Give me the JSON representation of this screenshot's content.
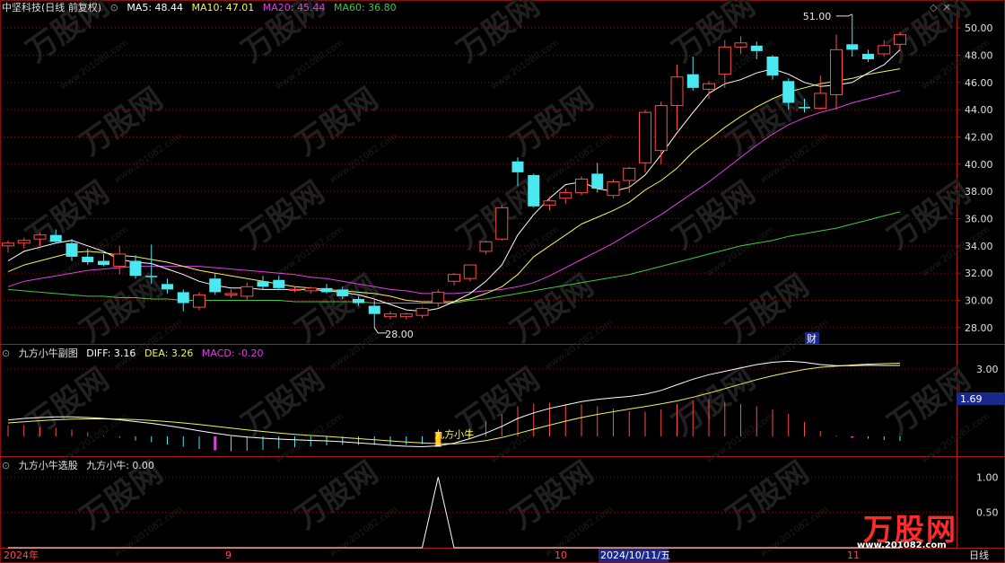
{
  "header": {
    "stock_label": "中坚科技(日线 前复权)",
    "ma5": "MA5: 48.44",
    "ma10": "MA10: 47.01",
    "ma20": "MA20: 45.44",
    "ma60": "MA60: 36.80"
  },
  "sub1": {
    "title": "九方小牛副图",
    "diff": "DIFF: 3.16",
    "dea": "DEA: 3.26",
    "macd": "MACD: -0.20",
    "marker_text": "九方小牛",
    "side_value": "1.69"
  },
  "sub2": {
    "title": "九方小牛选股",
    "value": "九方小牛: 0.00"
  },
  "annotations": {
    "high_label": "51.00",
    "low_label": "28.00",
    "event_badge": "财"
  },
  "bottom_bar": {
    "year": "2024年",
    "m9": "9",
    "m10": "10",
    "cursor_date": "2024/10/11/五",
    "m11": "11",
    "period": "日线"
  },
  "watermark": {
    "brand": "万股网",
    "url": "www.201082.com"
  },
  "colors": {
    "up": "#ff4a4a",
    "down": "#4ae8f0",
    "ma5": "#ffffff",
    "ma10": "#f2f25a",
    "ma20": "#e040e0",
    "ma60": "#3ec83e",
    "grid": "#7a1010"
  },
  "chart_data": [
    {
      "type": "candlestick",
      "title": "中坚科技(日线 前复权)",
      "ylim": [
        27.0,
        50.6
      ],
      "yticks": [
        "28.00",
        "30.00",
        "32.00",
        "34.00",
        "36.00",
        "38.00",
        "40.00",
        "42.00",
        "44.00",
        "46.00",
        "48.00",
        "50.00"
      ],
      "ohlc": [
        [
          34.0,
          34.4,
          33.5,
          34.2
        ],
        [
          34.2,
          34.6,
          33.8,
          34.4
        ],
        [
          34.5,
          35.0,
          34.0,
          34.8
        ],
        [
          34.8,
          35.2,
          34.2,
          34.3
        ],
        [
          34.2,
          34.5,
          32.9,
          33.2
        ],
        [
          33.2,
          33.8,
          32.6,
          32.8
        ],
        [
          32.9,
          33.4,
          32.5,
          32.6
        ],
        [
          32.5,
          34.0,
          31.9,
          33.4
        ],
        [
          32.9,
          33.3,
          31.6,
          31.8
        ],
        [
          31.8,
          34.1,
          31.2,
          31.7
        ],
        [
          31.2,
          31.6,
          30.5,
          30.8
        ],
        [
          30.6,
          30.8,
          29.2,
          29.8
        ],
        [
          29.5,
          30.6,
          29.3,
          30.4
        ],
        [
          31.6,
          32.0,
          30.4,
          30.6
        ],
        [
          30.4,
          30.8,
          30.2,
          30.5
        ],
        [
          30.3,
          31.3,
          30.0,
          31.0
        ],
        [
          31.4,
          31.8,
          30.8,
          31.0
        ],
        [
          31.5,
          31.8,
          30.8,
          30.9
        ],
        [
          30.8,
          31.0,
          30.6,
          30.8
        ],
        [
          30.7,
          31.0,
          30.5,
          30.9
        ],
        [
          30.9,
          31.2,
          30.5,
          30.6
        ],
        [
          30.8,
          31.0,
          30.1,
          30.3
        ],
        [
          30.1,
          30.3,
          29.6,
          29.8
        ],
        [
          29.6,
          30.0,
          28.0,
          29.0
        ],
        [
          28.8,
          29.2,
          28.6,
          29.0
        ],
        [
          28.8,
          29.1,
          28.6,
          29.0
        ],
        [
          28.9,
          29.5,
          28.7,
          29.4
        ],
        [
          29.8,
          30.8,
          29.5,
          30.6
        ],
        [
          31.4,
          32.0,
          31.1,
          31.9
        ],
        [
          31.6,
          32.6,
          31.4,
          32.6
        ],
        [
          33.6,
          34.4,
          33.4,
          34.3
        ],
        [
          34.5,
          37.0,
          34.4,
          36.8
        ],
        [
          40.2,
          40.5,
          38.4,
          39.4
        ],
        [
          39.2,
          39.3,
          36.8,
          36.9
        ],
        [
          37.0,
          37.6,
          36.6,
          37.3
        ],
        [
          37.5,
          38.2,
          37.1,
          37.9
        ],
        [
          37.9,
          39.1,
          37.7,
          38.9
        ],
        [
          39.3,
          40.1,
          37.9,
          38.2
        ],
        [
          37.7,
          38.9,
          37.5,
          38.7
        ],
        [
          38.8,
          39.8,
          37.9,
          39.7
        ],
        [
          40.1,
          44.0,
          39.4,
          43.8
        ],
        [
          41.0,
          44.6,
          40.0,
          44.3
        ],
        [
          44.3,
          47.3,
          42.5,
          46.4
        ],
        [
          46.6,
          47.9,
          45.4,
          45.6
        ],
        [
          45.5,
          46.1,
          44.8,
          45.9
        ],
        [
          46.6,
          49.1,
          45.6,
          48.6
        ],
        [
          48.6,
          49.4,
          48.1,
          48.9
        ],
        [
          48.7,
          49.0,
          47.7,
          48.3
        ],
        [
          47.9,
          48.0,
          46.2,
          46.5
        ],
        [
          46.1,
          46.3,
          44.0,
          44.5
        ],
        [
          44.2,
          44.8,
          43.8,
          44.1
        ],
        [
          44.1,
          46.5,
          44.0,
          45.2
        ],
        [
          45.1,
          49.5,
          44.0,
          48.4
        ],
        [
          48.8,
          51.0,
          47.9,
          48.4
        ],
        [
          48.1,
          48.4,
          47.5,
          47.7
        ],
        [
          48.1,
          49.1,
          47.9,
          48.7
        ],
        [
          48.8,
          49.7,
          48.3,
          49.5
        ]
      ],
      "ma5": [
        32.9,
        33.6,
        33.9,
        34.2,
        34.4,
        34.0,
        33.6,
        33.0,
        32.8,
        32.7,
        32.3,
        31.9,
        31.4,
        31.1,
        30.9,
        30.9,
        30.8,
        30.8,
        30.8,
        30.8,
        30.7,
        30.6,
        30.4,
        30.1,
        29.7,
        29.3,
        29.2,
        29.4,
        29.9,
        30.5,
        31.4,
        32.6,
        34.8,
        36.3,
        37.5,
        38.5,
        38.7,
        38.2,
        38.0,
        38.3,
        39.2,
        40.7,
        42.3,
        43.8,
        45.2,
        45.9,
        46.2,
        46.7,
        47.0,
        46.6,
        46.0,
        45.7,
        45.8,
        46.0,
        46.7,
        47.3,
        48.4
      ],
      "ma10": [
        32.1,
        32.6,
        32.9,
        33.2,
        33.5,
        33.6,
        33.5,
        33.3,
        33.2,
        33.0,
        32.8,
        32.5,
        32.2,
        32.0,
        31.8,
        31.6,
        31.4,
        31.2,
        31.0,
        30.9,
        30.8,
        30.7,
        30.6,
        30.5,
        30.3,
        30.0,
        29.9,
        29.9,
        29.9,
        30.1,
        30.5,
        31.0,
        31.9,
        33.2,
        34.0,
        34.8,
        35.6,
        36.1,
        36.6,
        37.2,
        38.1,
        38.8,
        39.7,
        40.9,
        41.8,
        42.7,
        43.5,
        44.2,
        44.8,
        45.3,
        45.6,
        45.9,
        46.1,
        46.3,
        46.6,
        46.8,
        47.0
      ],
      "ma20": [
        31.0,
        31.4,
        31.6,
        31.8,
        32.0,
        32.2,
        32.3,
        32.4,
        32.5,
        32.5,
        32.5,
        32.5,
        32.5,
        32.4,
        32.3,
        32.2,
        32.1,
        32.0,
        31.9,
        31.7,
        31.6,
        31.4,
        31.2,
        31.0,
        30.8,
        30.7,
        30.5,
        30.5,
        30.5,
        30.6,
        30.7,
        30.8,
        31.0,
        31.3,
        31.8,
        32.4,
        33.0,
        33.6,
        34.2,
        34.9,
        35.6,
        36.3,
        37.1,
        37.9,
        38.7,
        39.6,
        40.5,
        41.4,
        42.2,
        42.9,
        43.4,
        43.8,
        44.1,
        44.5,
        44.8,
        45.1,
        45.4
      ],
      "ma60": [
        30.8,
        30.7,
        30.6,
        30.5,
        30.4,
        30.3,
        30.3,
        30.2,
        30.2,
        30.1,
        30.1,
        30.0,
        30.0,
        30.0,
        30.0,
        30.0,
        30.0,
        30.0,
        29.9,
        29.9,
        29.9,
        29.9,
        29.9,
        29.8,
        29.8,
        29.8,
        29.8,
        29.8,
        29.8,
        30.0,
        30.1,
        30.3,
        30.5,
        30.7,
        30.9,
        31.1,
        31.3,
        31.5,
        31.7,
        31.9,
        32.2,
        32.5,
        32.8,
        33.1,
        33.4,
        33.7,
        34.0,
        34.2,
        34.4,
        34.7,
        34.9,
        35.1,
        35.3,
        35.6,
        35.9,
        36.2,
        36.5
      ]
    },
    {
      "type": "bar",
      "title": "九方小牛副图",
      "ylim": [
        -0.8,
        4.0
      ],
      "yticks": [
        "3.00"
      ],
      "diff": [
        0.73,
        0.8,
        0.84,
        0.87,
        0.87,
        0.84,
        0.8,
        0.74,
        0.66,
        0.58,
        0.48,
        0.37,
        0.25,
        0.14,
        0.04,
        -0.03,
        -0.08,
        -0.12,
        -0.15,
        -0.18,
        -0.2,
        -0.24,
        -0.29,
        -0.34,
        -0.4,
        -0.44,
        -0.46,
        -0.42,
        -0.3,
        -0.1,
        0.15,
        0.45,
        0.8,
        1.05,
        1.25,
        1.4,
        1.55,
        1.65,
        1.72,
        1.78,
        1.88,
        2.05,
        2.3,
        2.55,
        2.75,
        2.9,
        3.05,
        3.2,
        3.3,
        3.35,
        3.3,
        3.2,
        3.15,
        3.15,
        3.17,
        3.16,
        3.16
      ],
      "dea": [
        0.6,
        0.65,
        0.7,
        0.74,
        0.77,
        0.78,
        0.78,
        0.77,
        0.75,
        0.71,
        0.66,
        0.6,
        0.53,
        0.45,
        0.37,
        0.29,
        0.22,
        0.15,
        0.09,
        0.04,
        0.0,
        -0.05,
        -0.1,
        -0.15,
        -0.2,
        -0.25,
        -0.29,
        -0.32,
        -0.33,
        -0.28,
        -0.19,
        -0.05,
        0.13,
        0.32,
        0.5,
        0.68,
        0.84,
        0.98,
        1.1,
        1.22,
        1.33,
        1.45,
        1.58,
        1.75,
        1.93,
        2.13,
        2.33,
        2.53,
        2.7,
        2.85,
        2.98,
        3.08,
        3.13,
        3.18,
        3.22,
        3.24,
        3.26
      ],
      "macd": [
        0.5,
        0.5,
        0.42,
        0.38,
        0.3,
        0.18,
        0.04,
        -0.06,
        -0.18,
        -0.26,
        -0.36,
        -0.46,
        -0.56,
        -0.62,
        -0.66,
        -0.64,
        -0.6,
        -0.54,
        -0.48,
        -0.44,
        -0.4,
        -0.38,
        -0.38,
        -0.38,
        -0.4,
        -0.38,
        -0.34,
        -0.2,
        0.06,
        0.36,
        0.68,
        1.0,
        1.34,
        1.46,
        1.5,
        1.44,
        1.42,
        1.34,
        1.24,
        1.12,
        1.1,
        1.2,
        1.44,
        1.6,
        1.64,
        1.54,
        1.44,
        1.34,
        1.2,
        1.0,
        0.64,
        0.24,
        0.04,
        -0.06,
        -0.1,
        -0.16,
        -0.2
      ]
    },
    {
      "type": "line",
      "title": "九方小牛选股",
      "ylim": [
        0,
        1.08
      ],
      "yticks": [
        "1.00",
        "0.50"
      ],
      "values": [
        0,
        0,
        0,
        0,
        0,
        0,
        0,
        0,
        0,
        0,
        0,
        0,
        0,
        0,
        0,
        0,
        0,
        0,
        0,
        0,
        0,
        0,
        0,
        0,
        0,
        0,
        0,
        1,
        0,
        0,
        0,
        0,
        0,
        0,
        0,
        0,
        0,
        0,
        0,
        0,
        0,
        0,
        0,
        0,
        0,
        0,
        0,
        0,
        0,
        0,
        0,
        0,
        0,
        0,
        0,
        0,
        0
      ]
    }
  ]
}
